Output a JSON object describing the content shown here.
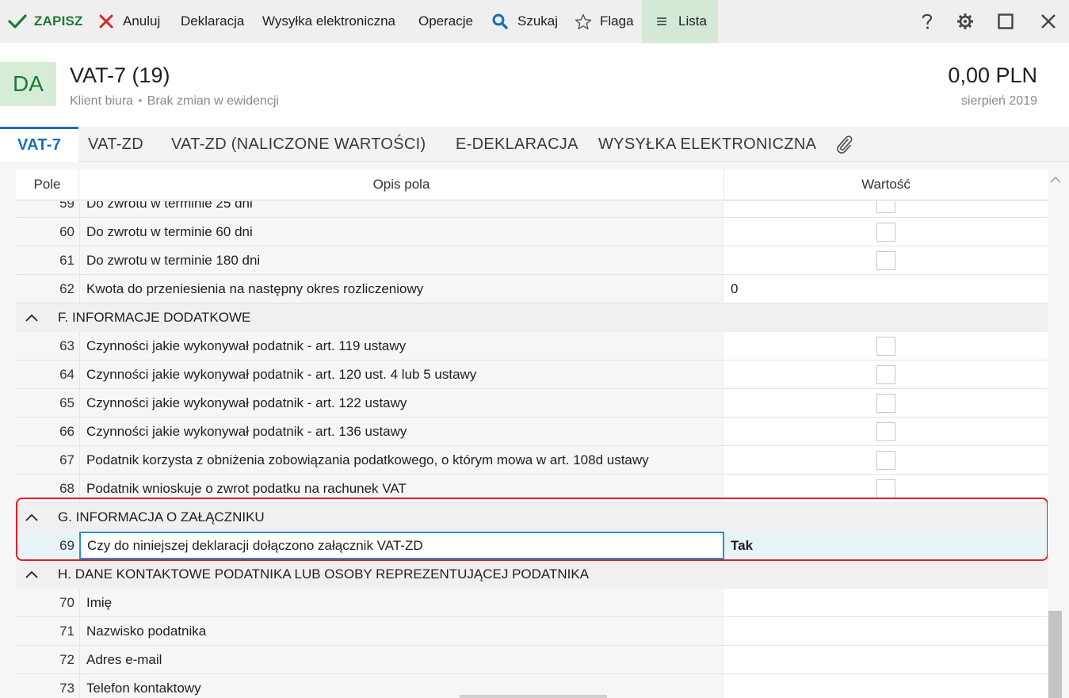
{
  "toolbar": {
    "save_label": "ZAPISZ",
    "cancel_label": "Anuluj",
    "declaration_label": "Deklaracja",
    "e_send_label": "Wysyłka elektroniczna",
    "operations_label": "Operacje",
    "search_label": "Szukaj",
    "flag_label": "Flaga",
    "list_label": "Lista",
    "icons": [
      "check-icon",
      "close-x-icon",
      "search-icon",
      "star-icon",
      "hamburger-icon",
      "help-icon",
      "gear-icon",
      "maximize-icon",
      "close-icon"
    ],
    "colors": {
      "save_green": "#1f7a35",
      "cancel_red": "#d42a2a",
      "search_blue": "#1a6fb5",
      "list_bg": "#d3e9d5"
    }
  },
  "header": {
    "avatar": "DA",
    "title": "VAT-7 (19)",
    "client": "Klient biura",
    "dot": "•",
    "status": "Brak zmian w ewidencji",
    "amount": "0,00 PLN",
    "period": "sierpień 2019"
  },
  "tabs": [
    {
      "label": "VAT-7",
      "active": true
    },
    {
      "label": "VAT-ZD"
    },
    {
      "label": "VAT-ZD (NALICZONE WARTOŚCI)"
    },
    {
      "label": "E-DEKLARACJA"
    },
    {
      "label": "WYSYŁKA ELEKTRONICZNA"
    }
  ],
  "grid": {
    "columns": {
      "pole": "Pole",
      "opis": "Opis pola",
      "wartosc": "Wartość"
    },
    "rows": [
      {
        "num": "59",
        "desc": "Do zwrotu w terminie 25 dni",
        "type": "checkbox"
      },
      {
        "num": "60",
        "desc": "Do zwrotu w terminie 60 dni",
        "type": "checkbox"
      },
      {
        "num": "61",
        "desc": "Do zwrotu w terminie 180 dni",
        "type": "checkbox"
      },
      {
        "num": "62",
        "desc": "Kwota do przeniesienia na następny okres rozliczeniowy",
        "type": "text",
        "value": "0"
      }
    ],
    "section_f": {
      "title": "F. INFORMACJE DODATKOWE",
      "rows": [
        {
          "num": "63",
          "desc": "Czynności jakie wykonywał podatnik - art. 119 ustawy"
        },
        {
          "num": "64",
          "desc": "Czynności jakie wykonywał podatnik - art. 120 ust. 4 lub 5 ustawy"
        },
        {
          "num": "65",
          "desc": "Czynności jakie wykonywał podatnik - art. 122 ustawy"
        },
        {
          "num": "66",
          "desc": "Czynności jakie wykonywał podatnik - art. 136 ustawy"
        },
        {
          "num": "67",
          "desc": "Podatnik korzysta z obniżenia zobowiązania podatkowego, o którym mowa w art. 108d ustawy"
        },
        {
          "num": "68",
          "desc": "Podatnik wnioskuje o zwrot podatku na rachunek VAT"
        }
      ]
    },
    "section_g": {
      "title": "G. INFORMACJA O ZAŁĄCZNIKU",
      "row": {
        "num": "69",
        "desc": "Czy do niniejszej deklaracji dołączono załącznik VAT-ZD",
        "value": "Tak"
      }
    },
    "section_h": {
      "title": "H. DANE KONTAKTOWE PODATNIKA LUB OSOBY REPREZENTUJĄCEJ PODATNIKA",
      "rows": [
        {
          "num": "70",
          "desc": "Imię"
        },
        {
          "num": "71",
          "desc": "Nazwisko podatnika"
        },
        {
          "num": "72",
          "desc": "Adres e-mail"
        },
        {
          "num": "73",
          "desc": "Telefon kontaktowy"
        }
      ]
    }
  }
}
